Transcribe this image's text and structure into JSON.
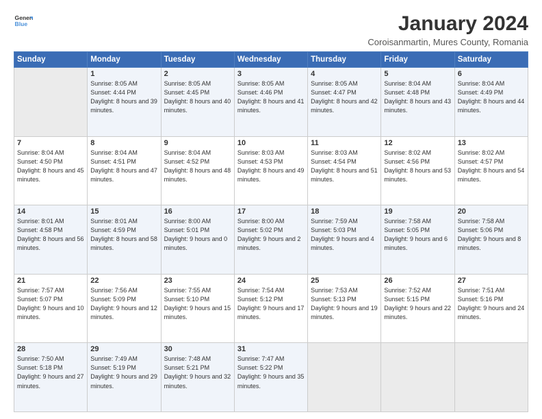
{
  "header": {
    "logo_general": "General",
    "logo_blue": "Blue",
    "month_title": "January 2024",
    "subtitle": "Coroisanmartin, Mures County, Romania"
  },
  "days_of_week": [
    "Sunday",
    "Monday",
    "Tuesday",
    "Wednesday",
    "Thursday",
    "Friday",
    "Saturday"
  ],
  "weeks": [
    [
      {
        "day": "",
        "empty": true
      },
      {
        "day": "1",
        "sunrise": "8:05 AM",
        "sunset": "4:44 PM",
        "daylight": "8 hours and 39 minutes."
      },
      {
        "day": "2",
        "sunrise": "8:05 AM",
        "sunset": "4:45 PM",
        "daylight": "8 hours and 40 minutes."
      },
      {
        "day": "3",
        "sunrise": "8:05 AM",
        "sunset": "4:46 PM",
        "daylight": "8 hours and 41 minutes."
      },
      {
        "day": "4",
        "sunrise": "8:05 AM",
        "sunset": "4:47 PM",
        "daylight": "8 hours and 42 minutes."
      },
      {
        "day": "5",
        "sunrise": "8:04 AM",
        "sunset": "4:48 PM",
        "daylight": "8 hours and 43 minutes."
      },
      {
        "day": "6",
        "sunrise": "8:04 AM",
        "sunset": "4:49 PM",
        "daylight": "8 hours and 44 minutes."
      }
    ],
    [
      {
        "day": "7",
        "sunrise": "8:04 AM",
        "sunset": "4:50 PM",
        "daylight": "8 hours and 45 minutes."
      },
      {
        "day": "8",
        "sunrise": "8:04 AM",
        "sunset": "4:51 PM",
        "daylight": "8 hours and 47 minutes."
      },
      {
        "day": "9",
        "sunrise": "8:04 AM",
        "sunset": "4:52 PM",
        "daylight": "8 hours and 48 minutes."
      },
      {
        "day": "10",
        "sunrise": "8:03 AM",
        "sunset": "4:53 PM",
        "daylight": "8 hours and 49 minutes."
      },
      {
        "day": "11",
        "sunrise": "8:03 AM",
        "sunset": "4:54 PM",
        "daylight": "8 hours and 51 minutes."
      },
      {
        "day": "12",
        "sunrise": "8:02 AM",
        "sunset": "4:56 PM",
        "daylight": "8 hours and 53 minutes."
      },
      {
        "day": "13",
        "sunrise": "8:02 AM",
        "sunset": "4:57 PM",
        "daylight": "8 hours and 54 minutes."
      }
    ],
    [
      {
        "day": "14",
        "sunrise": "8:01 AM",
        "sunset": "4:58 PM",
        "daylight": "8 hours and 56 minutes."
      },
      {
        "day": "15",
        "sunrise": "8:01 AM",
        "sunset": "4:59 PM",
        "daylight": "8 hours and 58 minutes."
      },
      {
        "day": "16",
        "sunrise": "8:00 AM",
        "sunset": "5:01 PM",
        "daylight": "9 hours and 0 minutes."
      },
      {
        "day": "17",
        "sunrise": "8:00 AM",
        "sunset": "5:02 PM",
        "daylight": "9 hours and 2 minutes."
      },
      {
        "day": "18",
        "sunrise": "7:59 AM",
        "sunset": "5:03 PM",
        "daylight": "9 hours and 4 minutes."
      },
      {
        "day": "19",
        "sunrise": "7:58 AM",
        "sunset": "5:05 PM",
        "daylight": "9 hours and 6 minutes."
      },
      {
        "day": "20",
        "sunrise": "7:58 AM",
        "sunset": "5:06 PM",
        "daylight": "9 hours and 8 minutes."
      }
    ],
    [
      {
        "day": "21",
        "sunrise": "7:57 AM",
        "sunset": "5:07 PM",
        "daylight": "9 hours and 10 minutes."
      },
      {
        "day": "22",
        "sunrise": "7:56 AM",
        "sunset": "5:09 PM",
        "daylight": "9 hours and 12 minutes."
      },
      {
        "day": "23",
        "sunrise": "7:55 AM",
        "sunset": "5:10 PM",
        "daylight": "9 hours and 15 minutes."
      },
      {
        "day": "24",
        "sunrise": "7:54 AM",
        "sunset": "5:12 PM",
        "daylight": "9 hours and 17 minutes."
      },
      {
        "day": "25",
        "sunrise": "7:53 AM",
        "sunset": "5:13 PM",
        "daylight": "9 hours and 19 minutes."
      },
      {
        "day": "26",
        "sunrise": "7:52 AM",
        "sunset": "5:15 PM",
        "daylight": "9 hours and 22 minutes."
      },
      {
        "day": "27",
        "sunrise": "7:51 AM",
        "sunset": "5:16 PM",
        "daylight": "9 hours and 24 minutes."
      }
    ],
    [
      {
        "day": "28",
        "sunrise": "7:50 AM",
        "sunset": "5:18 PM",
        "daylight": "9 hours and 27 minutes."
      },
      {
        "day": "29",
        "sunrise": "7:49 AM",
        "sunset": "5:19 PM",
        "daylight": "9 hours and 29 minutes."
      },
      {
        "day": "30",
        "sunrise": "7:48 AM",
        "sunset": "5:21 PM",
        "daylight": "9 hours and 32 minutes."
      },
      {
        "day": "31",
        "sunrise": "7:47 AM",
        "sunset": "5:22 PM",
        "daylight": "9 hours and 35 minutes."
      },
      {
        "day": "",
        "empty": true
      },
      {
        "day": "",
        "empty": true
      },
      {
        "day": "",
        "empty": true
      }
    ]
  ]
}
